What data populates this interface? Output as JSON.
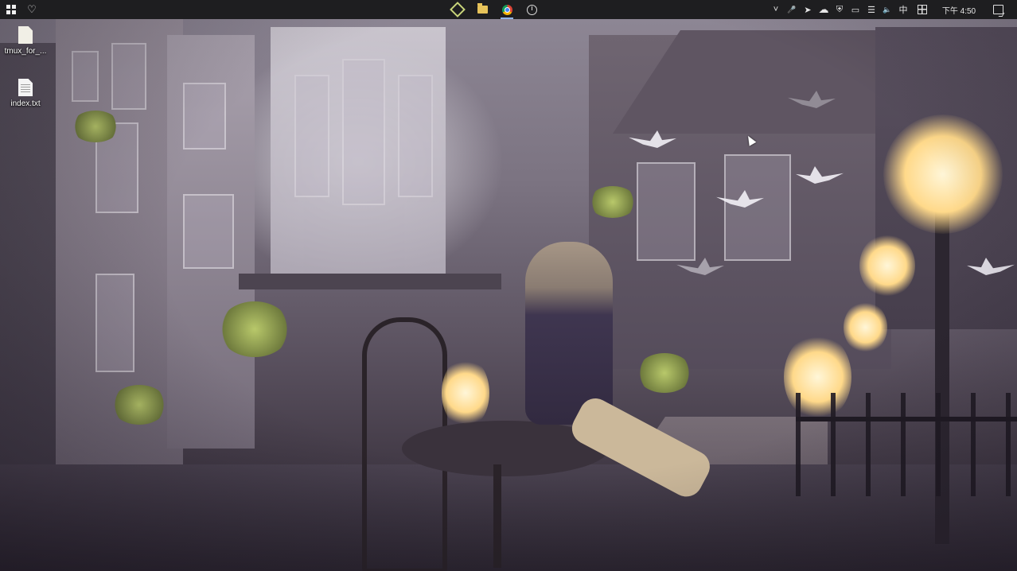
{
  "taskbar": {
    "start_icon": "windows-logo-icon",
    "quick_icon": "heart-icon",
    "pinned": [
      {
        "name": "app-diamond-icon",
        "active": false
      },
      {
        "name": "file-explorer-icon",
        "active": false
      },
      {
        "name": "chrome-icon",
        "active": true
      },
      {
        "name": "clock-app-icon",
        "active": false
      }
    ],
    "tray": {
      "chevron": "˅",
      "mic": "🎤",
      "send": "➤",
      "cloud": "☁",
      "shield": "⛨",
      "battery": "▭",
      "wifi": "☰",
      "volume": "🔈",
      "ime": "中",
      "ime_grid_icon": "ime-grid-icon"
    },
    "clock_text": "下午 4:50",
    "notification_icon": "notification-icon"
  },
  "desktop": {
    "icons": [
      {
        "label": "tmux_for_...",
        "type": "generic-file-icon"
      },
      {
        "label": "index.txt",
        "type": "text-file-icon"
      }
    ]
  },
  "colors": {
    "taskbar_bg": "#1e1e20",
    "active_indicator": "#8fb4e6"
  }
}
